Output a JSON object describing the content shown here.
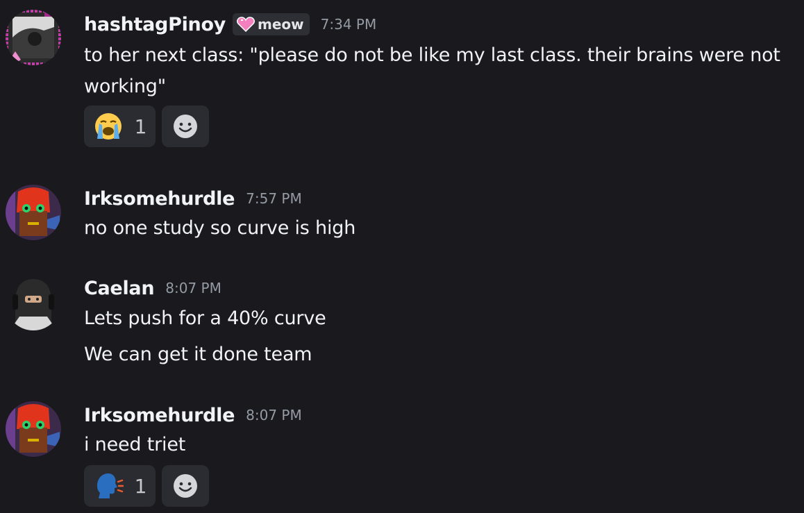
{
  "messages": [
    {
      "username": "hashtagPinoy",
      "tag": "meow",
      "time": "7:34 PM",
      "lines": [
        "to her next class: \"please do not be like my last class. their brains were not working\""
      ],
      "reaction": {
        "emoji": "loudly-crying-face",
        "count": "1"
      }
    },
    {
      "username": "Irksomehurdle",
      "time": "7:57 PM",
      "lines": [
        "no one study so curve is high"
      ]
    },
    {
      "username": "Caelan",
      "time": "8:07 PM",
      "lines": [
        "Lets push for a 40% curve",
        "We can get it done team"
      ]
    },
    {
      "username": "Irksomehurdle",
      "time": "8:07 PM",
      "lines": [
        "i need triet"
      ],
      "reaction": {
        "emoji": "speaking-head",
        "count": "1"
      }
    }
  ]
}
